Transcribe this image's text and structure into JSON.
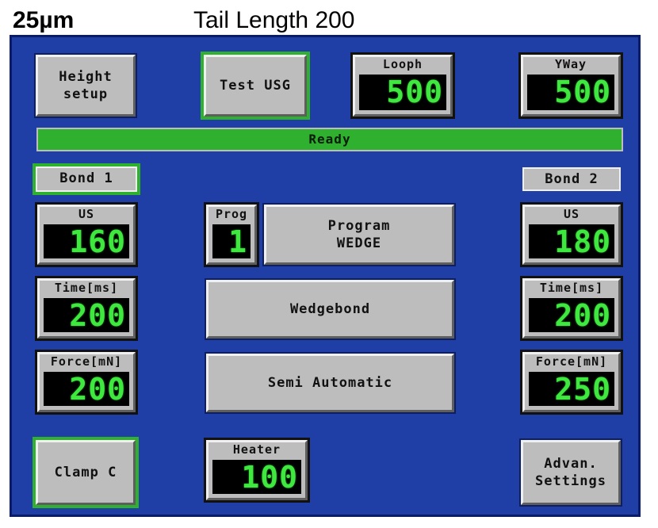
{
  "caption": {
    "wire": "25µm",
    "tail": "Tail Length 200"
  },
  "top": {
    "height_setup": "Height\nsetup",
    "test_usg": "Test USG",
    "looph": {
      "label": "Looph",
      "value": "500"
    },
    "yway": {
      "label": "YWay",
      "value": "500"
    }
  },
  "status": "Ready",
  "bond1": {
    "title": "Bond 1",
    "us": {
      "label": "US",
      "value": "160"
    },
    "time": {
      "label": "Time[ms]",
      "value": "200"
    },
    "force": {
      "label": "Force[mN]",
      "value": "200"
    }
  },
  "bond2": {
    "title": "Bond 2",
    "us": {
      "label": "US",
      "value": "180"
    },
    "time": {
      "label": "Time[ms]",
      "value": "200"
    },
    "force": {
      "label": "Force[mN]",
      "value": "250"
    }
  },
  "center": {
    "prog": {
      "label": "Prog",
      "value": "1"
    },
    "program": "Program\nWEDGE",
    "wedgebond": "Wedgebond",
    "semi_auto": "Semi Automatic",
    "heater": {
      "label": "Heater",
      "value": "100"
    }
  },
  "bottom": {
    "clamp": "Clamp C",
    "advanced": "Advan.\nSettings"
  },
  "colors": {
    "panel": "#1f3fa6",
    "button": "#bdbdbd",
    "active_green": "#2fb12f",
    "digit_green": "#3ee83e",
    "digit_bg": "#000000"
  }
}
